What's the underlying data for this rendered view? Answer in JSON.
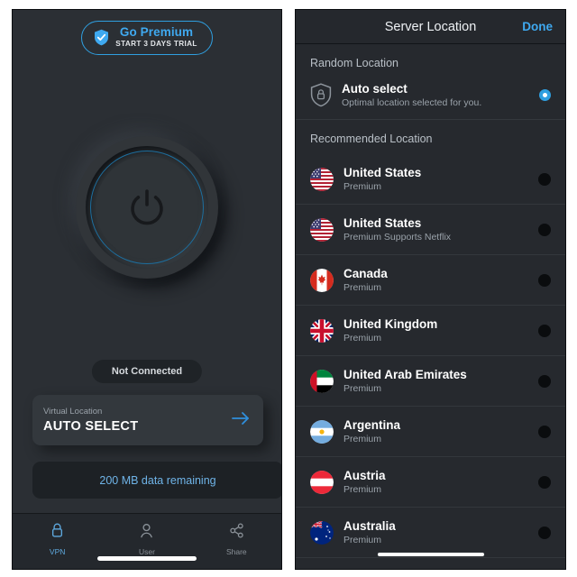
{
  "left_panel": {
    "premium_button": {
      "icon": "shield-check-icon",
      "title": "Go Premium",
      "subtitle": "START 3 DAYS TRIAL",
      "border_color": "#2f9fe0",
      "title_color": "#3fa9f0"
    },
    "power_button": {
      "icon": "power-icon",
      "ring_color": "#1d6e9e",
      "state": "off"
    },
    "status": {
      "text": "Not Connected"
    },
    "virtual_location": {
      "label": "Virtual Location",
      "value": "AUTO SELECT",
      "arrow_icon": "arrow-right-icon",
      "arrow_color": "#2f8fdc"
    },
    "data_remaining": {
      "text": "200 MB data remaining",
      "color": "#6fb4e8"
    },
    "tabs": [
      {
        "id": "vpn",
        "label": "VPN",
        "icon": "lock-icon",
        "active": true
      },
      {
        "id": "user",
        "label": "User",
        "icon": "person-icon",
        "active": false
      },
      {
        "id": "share",
        "label": "Share",
        "icon": "share-icon",
        "active": false
      }
    ]
  },
  "right_panel": {
    "nav": {
      "title": "Server Location",
      "done_label": "Done",
      "done_color": "#3fa9f0"
    },
    "random_section": {
      "heading": "Random Location",
      "item": {
        "icon": "shield-lock-icon",
        "title": "Auto select",
        "subtitle": "Optimal location selected for you.",
        "selected": true
      }
    },
    "recommended_section": {
      "heading": "Recommended Location",
      "items": [
        {
          "name": "United States",
          "tier": "Premium",
          "flag": "flag-us",
          "selected": false
        },
        {
          "name": "United States",
          "tier": "Premium Supports Netflix",
          "flag": "flag-us",
          "selected": false
        },
        {
          "name": "Canada",
          "tier": "Premium",
          "flag": "flag-ca",
          "selected": false
        },
        {
          "name": "United Kingdom",
          "tier": "Premium",
          "flag": "flag-gb",
          "selected": false
        },
        {
          "name": "United Arab Emirates",
          "tier": "Premium",
          "flag": "flag-ae",
          "selected": false
        },
        {
          "name": "Argentina",
          "tier": "Premium",
          "flag": "flag-ar",
          "selected": false
        },
        {
          "name": "Austria",
          "tier": "Premium",
          "flag": "flag-at",
          "selected": false
        },
        {
          "name": "Australia",
          "tier": "Premium",
          "flag": "flag-au",
          "selected": false
        }
      ]
    }
  }
}
